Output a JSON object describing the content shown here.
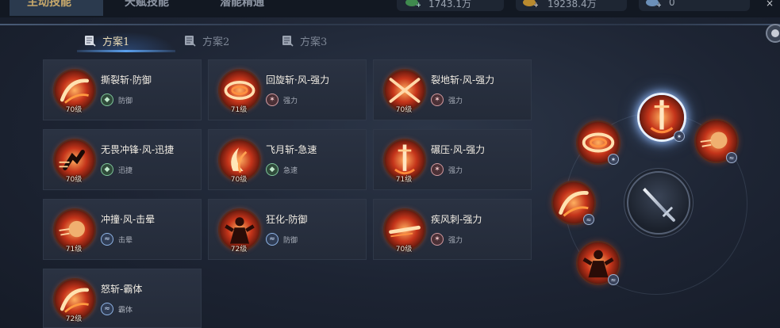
{
  "top": {
    "tabs": [
      "主动技能",
      "天赋技能",
      "潜能精通"
    ],
    "resources": [
      "1743.1万",
      "19238.4万",
      "0"
    ],
    "close_glyph": "×"
  },
  "schemes": [
    "方案1",
    "方案2",
    "方案3"
  ],
  "skills": [
    {
      "name": "撕裂斩·防御",
      "level": "70级",
      "tag": "防御",
      "tag_type": "defense",
      "art": "slash-arc"
    },
    {
      "name": "回旋斩·风-强力",
      "level": "71级",
      "tag": "强力",
      "tag_type": "power",
      "art": "spin"
    },
    {
      "name": "裂地斩·风-强力",
      "level": "70级",
      "tag": "强力",
      "tag_type": "power",
      "art": "cross"
    },
    {
      "name": "无畏冲锋·风-迅捷",
      "level": "70级",
      "tag": "迅捷",
      "tag_type": "defense",
      "art": "charge"
    },
    {
      "name": "飞月斩-急速",
      "level": "70级",
      "tag": "急速",
      "tag_type": "defense",
      "art": "moon"
    },
    {
      "name": "碾压·风-强力",
      "level": "71级",
      "tag": "强力",
      "tag_type": "power",
      "art": "sword-down"
    },
    {
      "name": "冲撞·风-击晕",
      "level": "71级",
      "tag": "击晕",
      "tag_type": "stun",
      "art": "fist"
    },
    {
      "name": "狂化-防御",
      "level": "72级",
      "tag": "防御",
      "tag_type": "stun",
      "art": "rage"
    },
    {
      "name": "疾风刺-强力",
      "level": "70级",
      "tag": "强力",
      "tag_type": "power",
      "art": "thrust"
    },
    {
      "name": "怒斩-霸体",
      "level": "72级",
      "tag": "霸体",
      "tag_type": "stun",
      "art": "slash-arc"
    }
  ],
  "wheel": {
    "center_icon": "sword-icon",
    "slots": [
      {
        "art": "sword-down",
        "badge": "power",
        "selected": true
      },
      {
        "art": "spin",
        "badge": "power",
        "selected": false
      },
      {
        "art": "fist",
        "badge": "stun",
        "selected": false
      },
      {
        "art": "slash-arc",
        "badge": "stun",
        "selected": false
      },
      {
        "art": "rage",
        "badge": "stun",
        "selected": false
      }
    ]
  },
  "colors": {
    "accent_gold": "#c8a96b",
    "tab_active": "#5aa0ee",
    "fire": "#e8501f"
  }
}
